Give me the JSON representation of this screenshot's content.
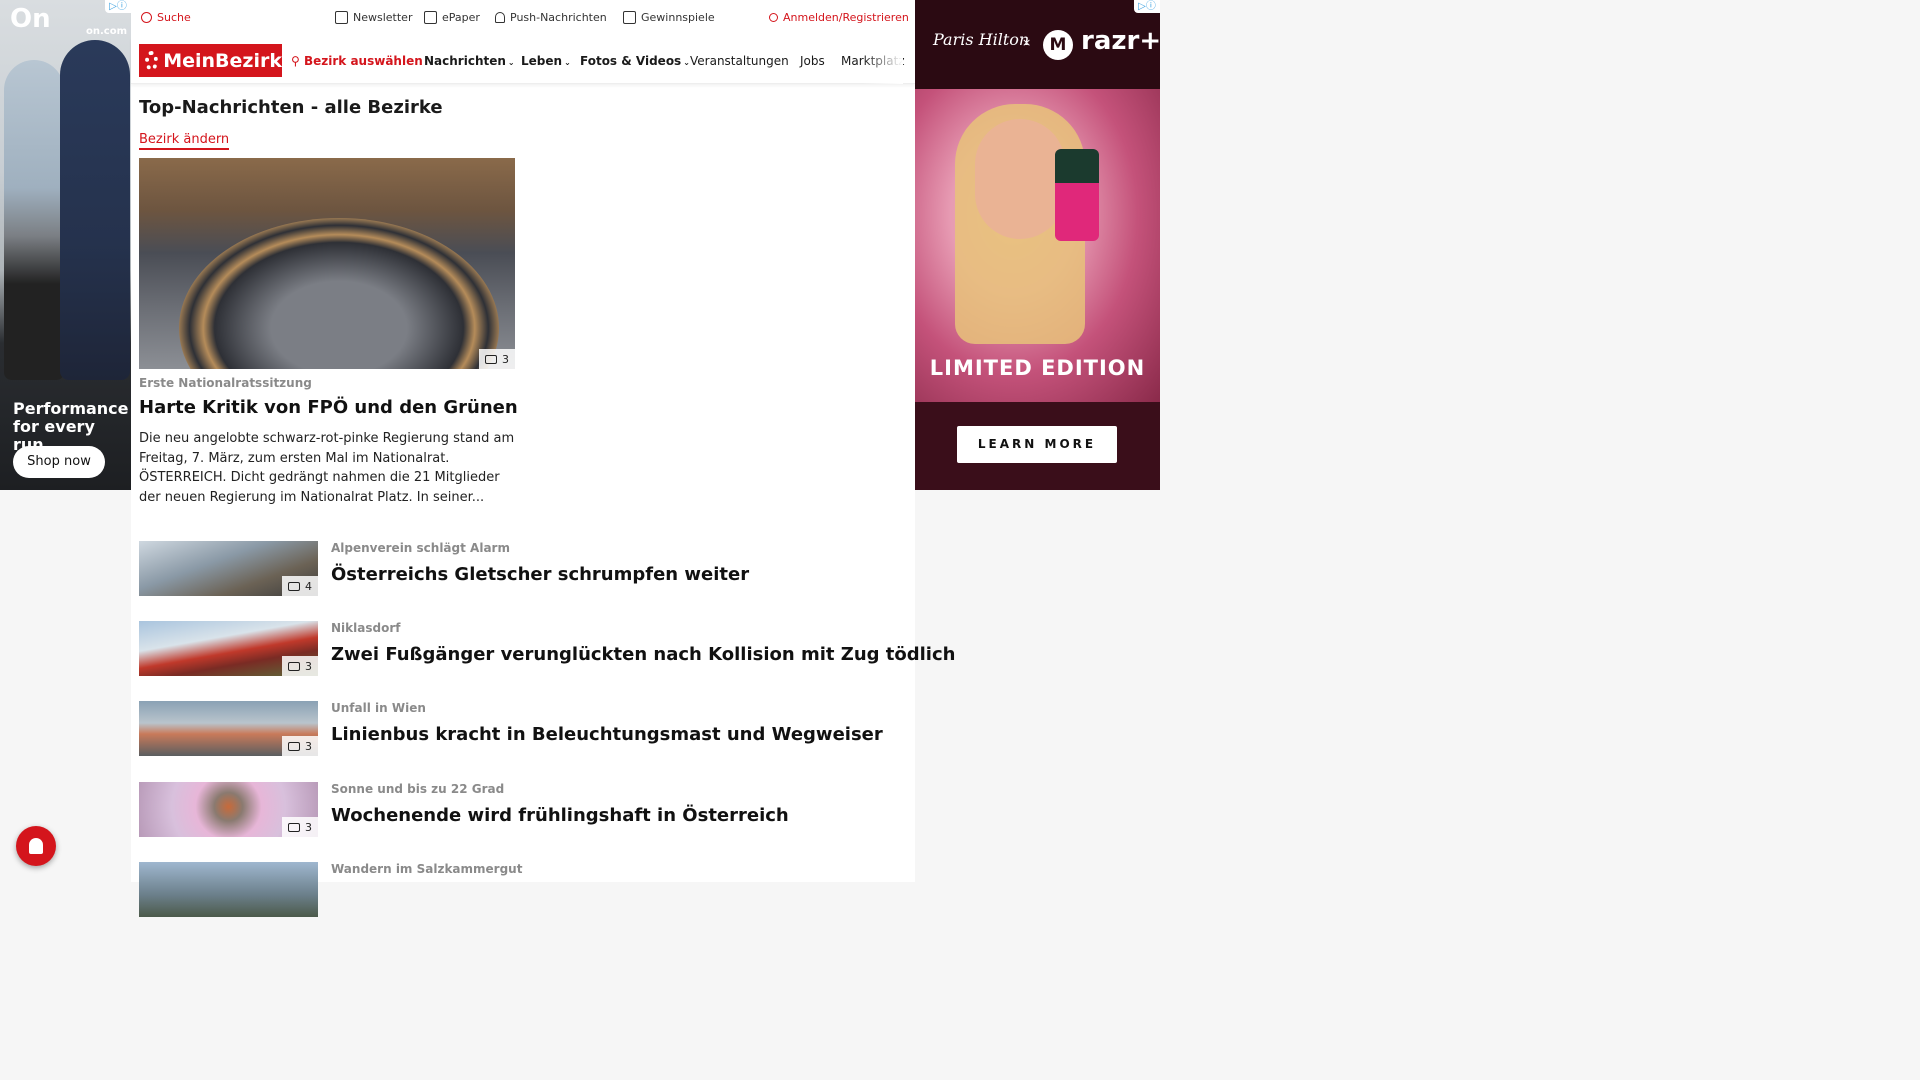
{
  "left_ad": {
    "brand": "On",
    "url": "on.com",
    "tagline": "Performance for every run",
    "cta": "Shop now"
  },
  "topbar": {
    "search": "Suche",
    "newsletter": "Newsletter",
    "epaper": "ePaper",
    "push": "Push-Nachrichten",
    "contests": "Gewinnspiele",
    "login": "Anmelden/Registrieren"
  },
  "nav": {
    "logo": "MeinBezirk",
    "district_select": "Bezirk auswählen",
    "items": [
      "Nachrichten",
      "Leben",
      "Fotos & Videos",
      "Veranstaltungen",
      "Jobs",
      "Marktplatz"
    ]
  },
  "main": {
    "page_title": "Top-Nachrichten - alle Bezirke",
    "change_district": "Bezirk ändern",
    "hero": {
      "image_count": "3",
      "kicker": "Erste Nationalratssitzung",
      "title": "Harte Kritik von FPÖ und den Grünen",
      "teaser": "Die neu angelobte schwarz-rot-pinke Regierung stand am Freitag, 7. März, zum ersten Mal im Nationalrat. ÖSTERREICH. Dicht gedrängt nahmen die 21 Mitglieder der neuen Regierung im Nationalrat Platz. In seiner..."
    },
    "articles": [
      {
        "kicker": "Alpenverein schlägt Alarm",
        "title": "Österreichs Gletscher schrumpfen weiter",
        "image_count": "4"
      },
      {
        "kicker": "Niklasdorf",
        "title": "Zwei Fußgänger verunglückten nach Kollision mit Zug tödlich",
        "image_count": "3"
      },
      {
        "kicker": "Unfall in Wien",
        "title": "Linienbus kracht in Beleuchtungsmast und Wegweiser",
        "image_count": "3"
      },
      {
        "kicker": "Sonne und bis zu 22 Grad",
        "title": "Wochenende wird frühlingshaft in Österreich",
        "image_count": "3"
      },
      {
        "kicker": "Wandern im Salzkammergut",
        "title": "",
        "image_count": ""
      }
    ]
  },
  "right_ad": {
    "signature": "Paris Hilton",
    "times": "×",
    "moto_logo": "M",
    "product": "razr+",
    "headline": "LIMITED EDITION",
    "cta": "LEARN MORE"
  },
  "colors": {
    "brand_red": "#d4151c",
    "kicker_gray": "#8a8a8a"
  }
}
